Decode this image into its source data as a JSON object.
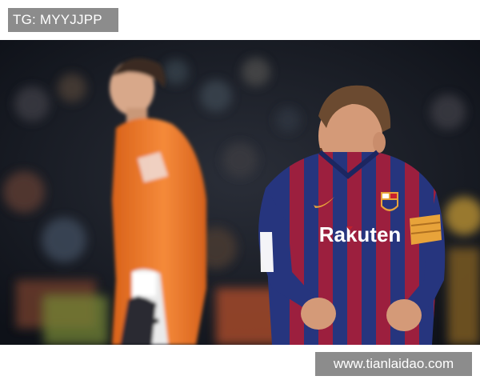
{
  "watermark_top": {
    "text": "TG: MYYJJPP"
  },
  "watermark_bottom": {
    "text": "www.tianlaidao.com"
  },
  "photo": {
    "icon": "soccer-photo",
    "jersey_sponsor": "Rakuten",
    "colors": {
      "crowd_dark": "#121620",
      "keeper_kit": "#f07a2a",
      "home_kit_blue": "#2a3a8a",
      "home_kit_red": "#a3203f",
      "captain_band": "#e8a33a",
      "skin": "#d49a78",
      "beard": "#6a3a1e"
    }
  }
}
